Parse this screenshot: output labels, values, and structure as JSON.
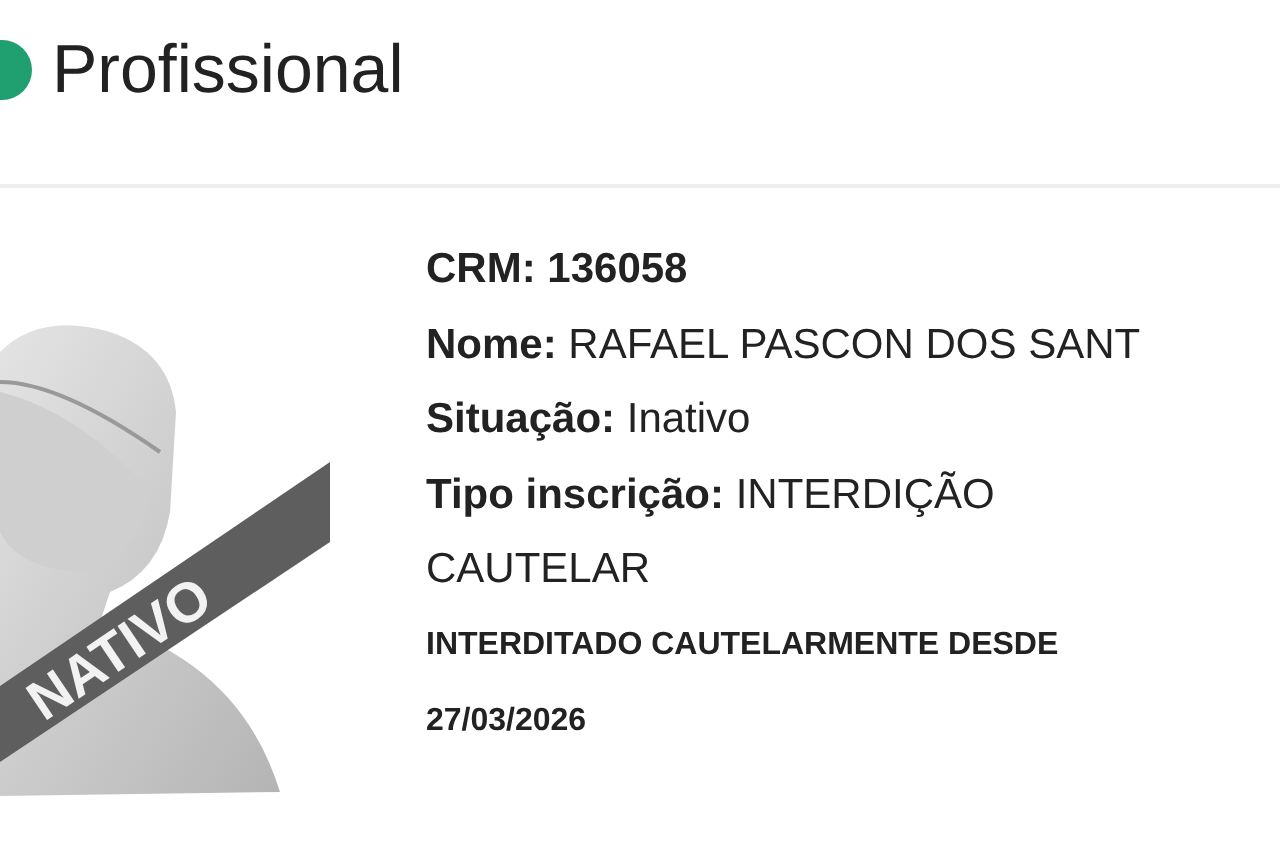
{
  "header": {
    "title": "Profissional"
  },
  "avatar": {
    "status_label": "NATIVO"
  },
  "fields": [
    {
      "text": "**CRM: 136058**"
    },
    {
      "text": "**Nome:** RAFAEL PASCON DOS SANT"
    },
    {
      "text": "**Situação:** Inativo"
    },
    {
      "text": "**Tipo inscrição:** INTERDIÇÃO CAUTELAR"
    }
  ],
  "note": "INTERDITADO CAUTELARMENTE DESDE 27/03/2026"
}
